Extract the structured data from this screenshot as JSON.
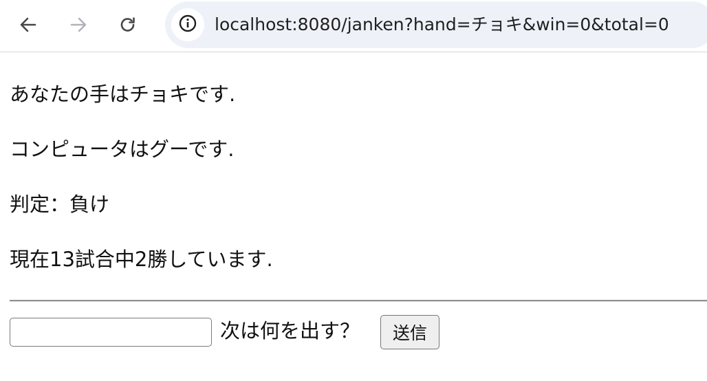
{
  "browser": {
    "url": "localhost:8080/janken?hand=チョキ&win=0&total=0",
    "icons": {
      "back": "arrow-left",
      "forward": "arrow-right",
      "reload": "reload",
      "site_info": "info-circle"
    },
    "colors": {
      "omnibox_bg": "#eef2f8",
      "icon_active": "#444746",
      "icon_disabled": "#b0b3b8"
    }
  },
  "result": {
    "player_hand_text": "あなたの手はチョキです.",
    "computer_hand_text": "コンピュータはグーです.",
    "judgement_text": "判定：負け",
    "record_text": "現在13試合中2勝しています."
  },
  "form": {
    "hand_input_value": "",
    "prompt_label": "次は何を出す？",
    "submit_label": "送信"
  }
}
